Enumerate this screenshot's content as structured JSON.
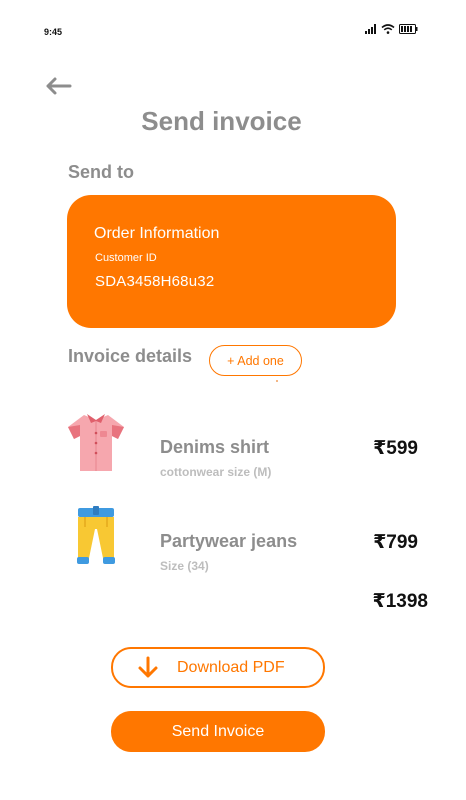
{
  "status_bar": {
    "time": "9:45",
    "icons": [
      "signal-icon",
      "wifi-icon",
      "battery-icon"
    ]
  },
  "header": {
    "back_icon": "back-arrow-icon",
    "title": "Send invoice"
  },
  "send_to": {
    "label": "Send to",
    "card": {
      "title": "Order Information",
      "customer_label": "Customer ID",
      "customer_id": "SDA3458H68u32"
    }
  },
  "invoice": {
    "label": "Invoice details",
    "add_button_label": "+ Add one",
    "items": [
      {
        "icon": "shirt-icon",
        "name": "Denims shirt",
        "detail": "cottonwear size (M)",
        "price": "₹599"
      },
      {
        "icon": "jeans-icon",
        "name": "Partywear jeans",
        "detail": "Size (34)",
        "price": "₹799"
      }
    ],
    "total": "₹1398"
  },
  "actions": {
    "download_label": "Download PDF",
    "download_icon": "download-arrow-icon",
    "send_label": "Send Invoice"
  },
  "colors": {
    "accent": "#ff7700",
    "muted_text": "#8d8d8d",
    "light_text": "#bdbdbd"
  }
}
